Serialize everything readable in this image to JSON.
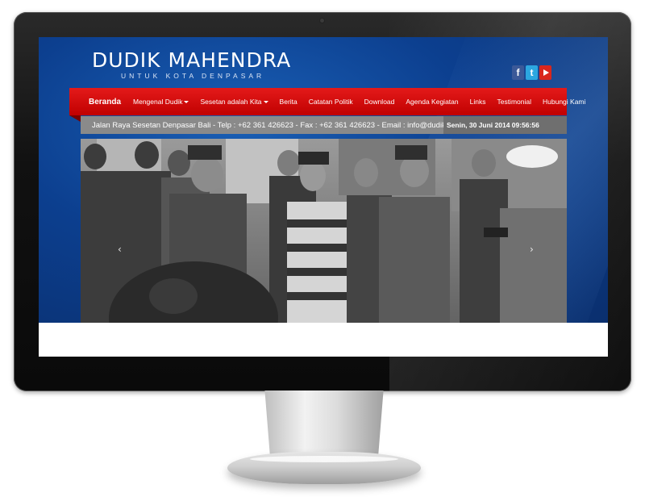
{
  "site": {
    "title": "DUDIK MAHENDRA",
    "tagline": "UNTUK KOTA DENPASAR"
  },
  "social": {
    "facebook_icon": "facebook-icon",
    "twitter_icon": "twitter-icon",
    "youtube_icon": "youtube-icon",
    "facebook_glyph": "f",
    "twitter_glyph": "t"
  },
  "nav": {
    "items": [
      {
        "label": "Beranda",
        "active": true,
        "dropdown": false
      },
      {
        "label": "Mengenal Dudik",
        "active": false,
        "dropdown": true
      },
      {
        "label": "Sesetan adalah Kita",
        "active": false,
        "dropdown": true
      },
      {
        "label": "Berita",
        "active": false,
        "dropdown": false
      },
      {
        "label": "Catatan Politik",
        "active": false,
        "dropdown": false
      },
      {
        "label": "Download",
        "active": false,
        "dropdown": false
      },
      {
        "label": "Agenda Kegiatan",
        "active": false,
        "dropdown": false
      },
      {
        "label": "Links",
        "active": false,
        "dropdown": false
      },
      {
        "label": "Testimonial",
        "active": false,
        "dropdown": false
      },
      {
        "label": "Hubungi Kami",
        "active": false,
        "dropdown": false
      }
    ]
  },
  "info_bar": {
    "address": "Jalan Raya Sesetan Denpasar Bali - Telp : +62 361 426623 - Fax : +62 361 426623 - Email : info@dudikmah",
    "datetime": "Senin, 30 Juni 2014 09:56:56"
  },
  "slider": {
    "prev_glyph": "‹",
    "next_glyph": "›"
  },
  "colors": {
    "nav_red": "#d40f0f",
    "hero_blue": "#0c3f8f",
    "info_grey": "#8a8a8a"
  }
}
